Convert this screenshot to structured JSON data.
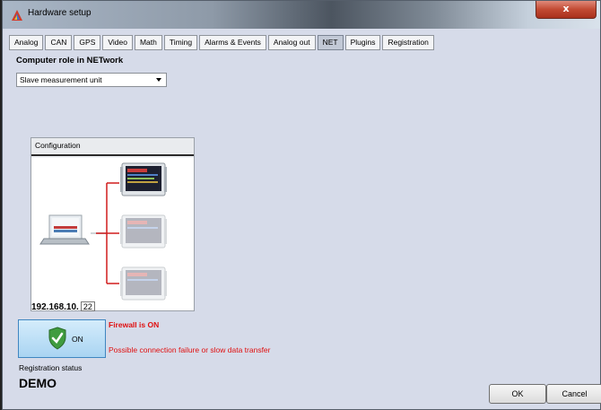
{
  "window": {
    "title": "Hardware setup",
    "close_label": "x"
  },
  "tabs": [
    {
      "label": "Analog",
      "active": false
    },
    {
      "label": "CAN",
      "active": false
    },
    {
      "label": "GPS",
      "active": false
    },
    {
      "label": "Video",
      "active": false
    },
    {
      "label": "Math",
      "active": false
    },
    {
      "label": "Timing",
      "active": false
    },
    {
      "label": "Alarms & Events",
      "active": false
    },
    {
      "label": "Analog out",
      "active": false
    },
    {
      "label": "NET",
      "active": true
    },
    {
      "label": "Plugins",
      "active": false
    },
    {
      "label": "Registration",
      "active": false
    }
  ],
  "network": {
    "section_title": "Computer role in NETwork",
    "role_value": "Slave measurement unit"
  },
  "configuration": {
    "title": "Configuration",
    "ip_prefix": "192.168.10.",
    "ip_last": "22"
  },
  "firewall": {
    "button_label": "ON",
    "status_title": "Firewall is ON",
    "warning": "Possible connection failure or slow data transfer",
    "status_color": "#e01010"
  },
  "registration": {
    "label": "Registration status",
    "value": "DEMO"
  },
  "buttons": {
    "ok": "OK",
    "cancel": "Cancel"
  }
}
